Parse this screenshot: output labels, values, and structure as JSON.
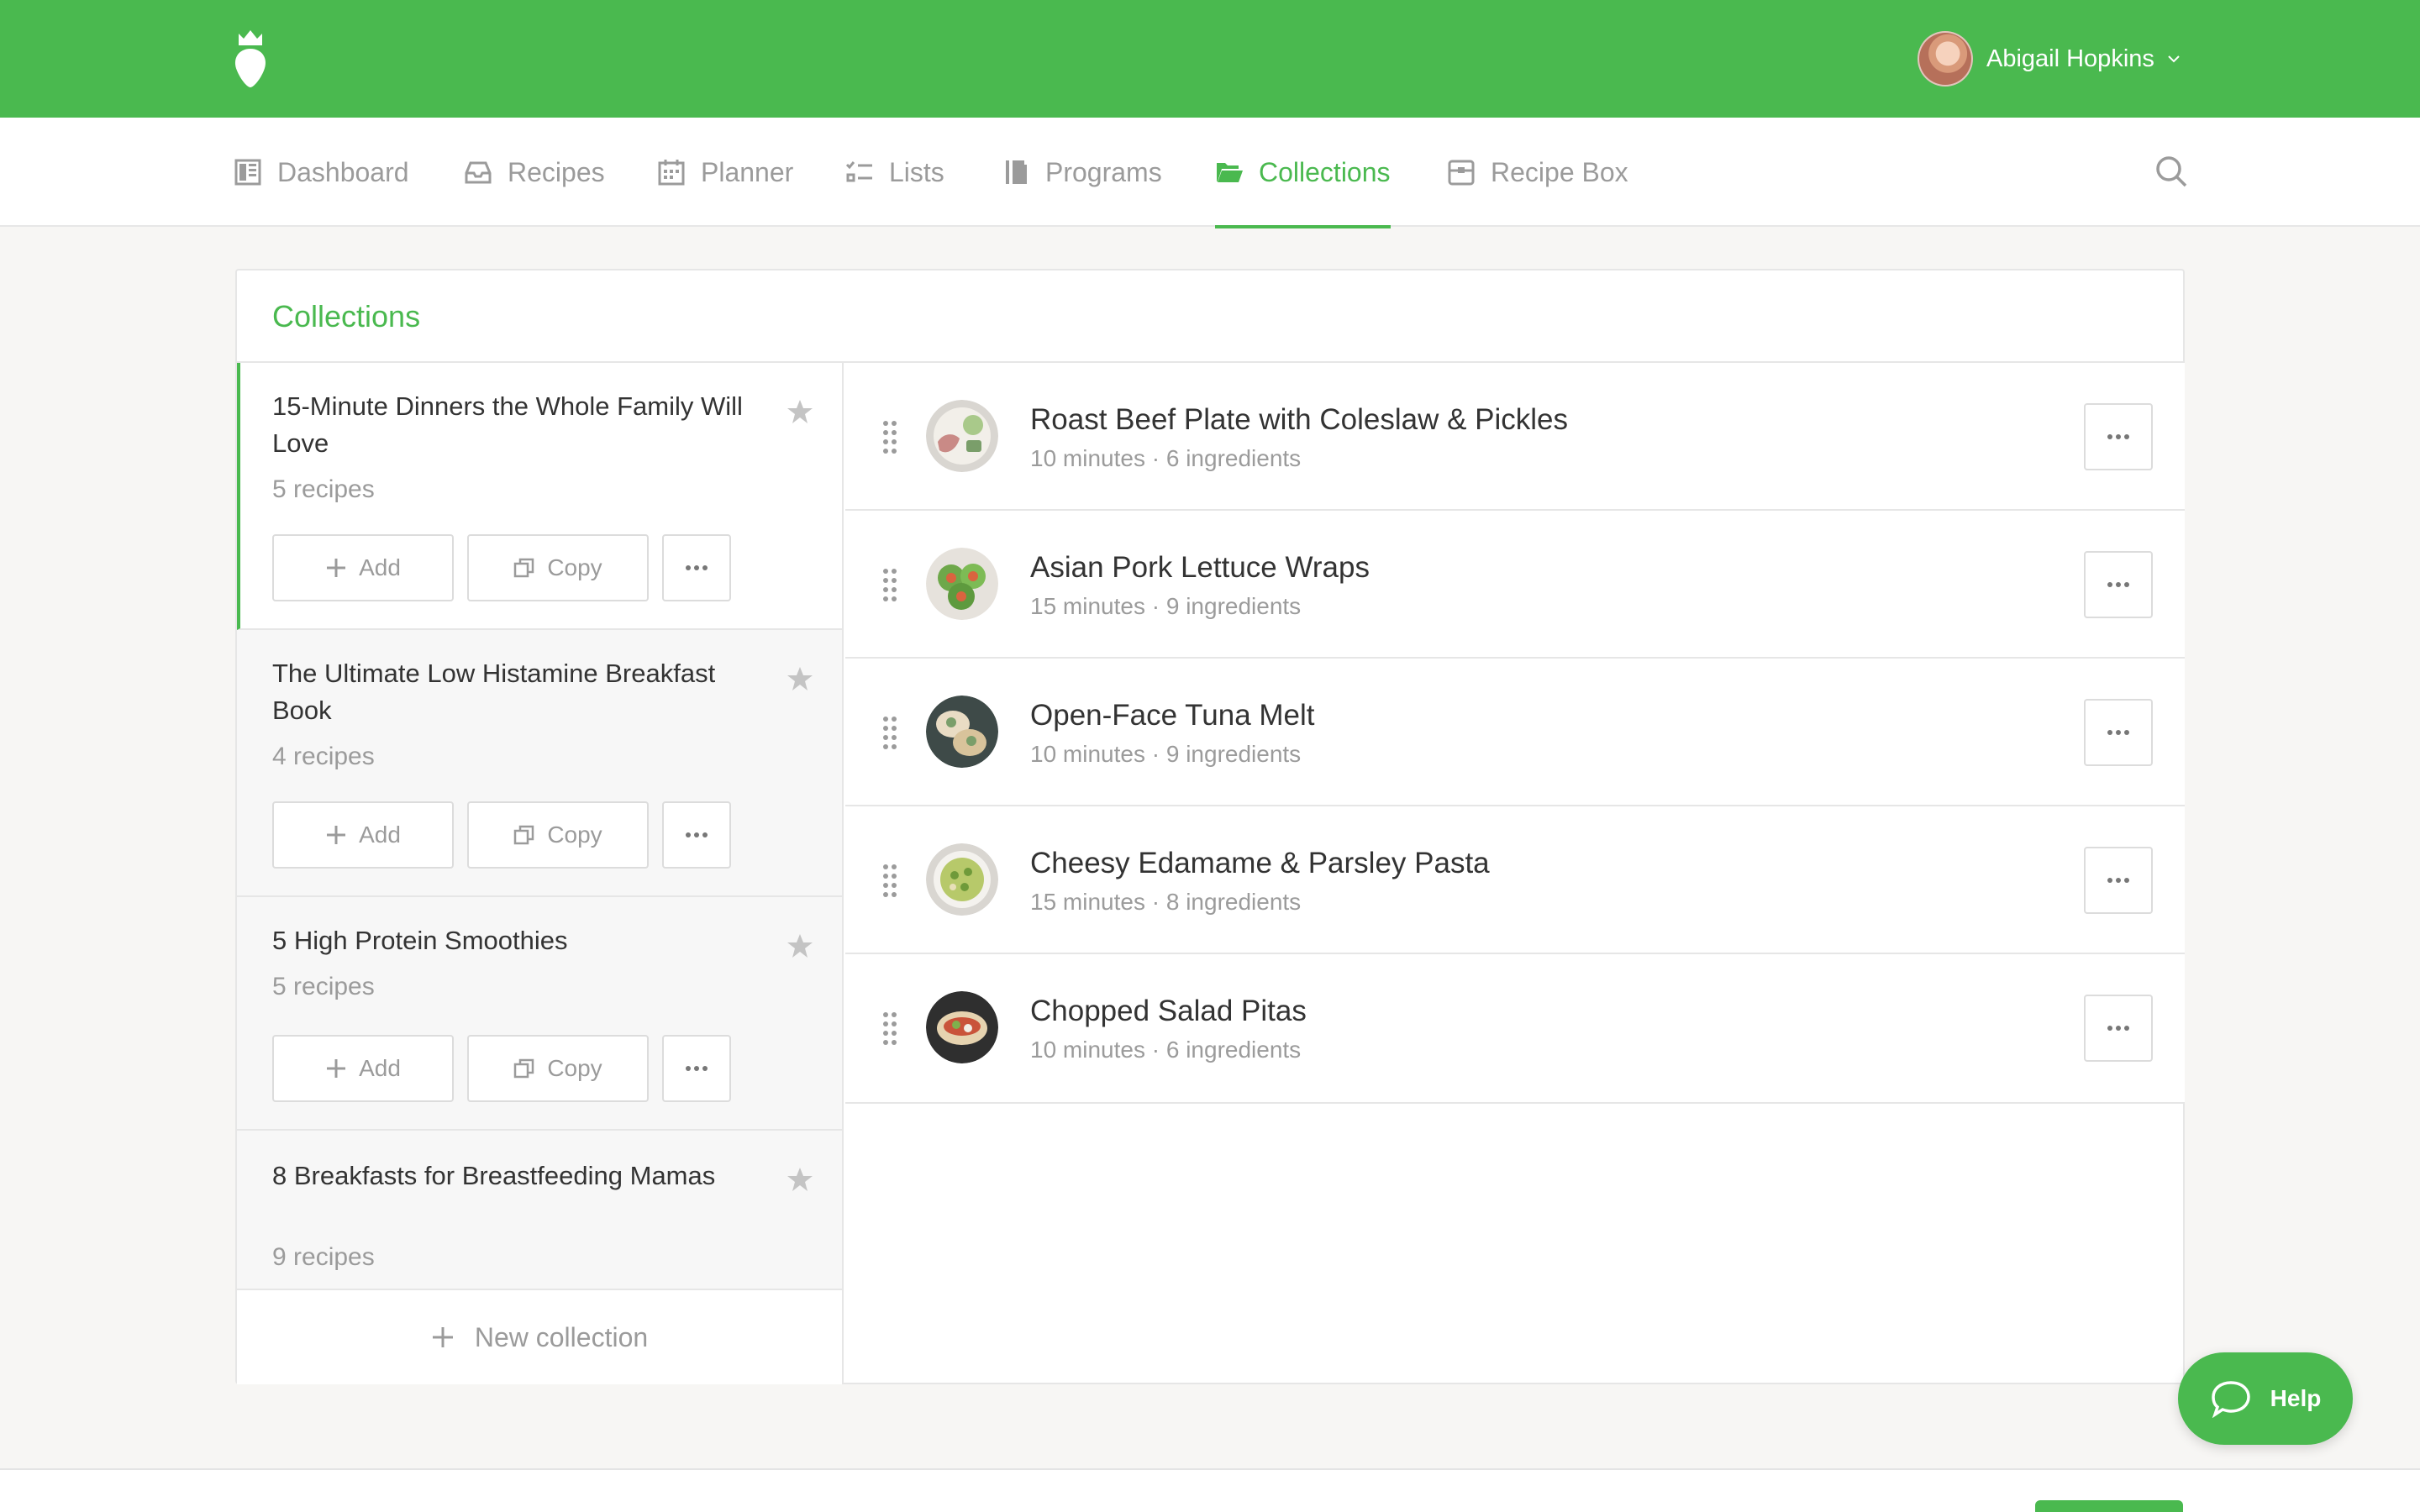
{
  "header": {
    "user_name": "Abigail Hopkins",
    "brand_color": "#4ab94f"
  },
  "nav": {
    "items": [
      {
        "label": "Dashboard",
        "icon": "dashboard-icon"
      },
      {
        "label": "Recipes",
        "icon": "recipes-icon"
      },
      {
        "label": "Planner",
        "icon": "calendar-icon"
      },
      {
        "label": "Lists",
        "icon": "checklist-icon"
      },
      {
        "label": "Programs",
        "icon": "book-icon"
      },
      {
        "label": "Collections",
        "icon": "folder-icon",
        "active": true
      },
      {
        "label": "Recipe Box",
        "icon": "box-icon"
      }
    ]
  },
  "panel": {
    "title": "Collections",
    "collections": [
      {
        "title": "15-Minute Dinners the Whole Family Will Love",
        "count": "5 recipes",
        "active": true
      },
      {
        "title": "The Ultimate Low Histamine Breakfast Book",
        "count": "4 recipes"
      },
      {
        "title": "5 High Protein Smoothies",
        "count": "5 recipes"
      },
      {
        "title": "8 Breakfasts for Breastfeeding Mamas",
        "count": "9 recipes"
      }
    ],
    "add_label": "Add",
    "copy_label": "Copy",
    "new_collection_label": "New collection"
  },
  "recipes": [
    {
      "title": "Roast Beef Plate with Coleslaw & Pickles",
      "meta": "10 minutes · 6 ingredients"
    },
    {
      "title": "Asian Pork Lettuce Wraps",
      "meta": "15 minutes · 9 ingredients"
    },
    {
      "title": "Open-Face Tuna Melt",
      "meta": "10 minutes · 9 ingredients"
    },
    {
      "title": "Cheesy Edamame & Parsley Pasta",
      "meta": "15 minutes · 8 ingredients"
    },
    {
      "title": "Chopped Salad Pitas",
      "meta": "10 minutes · 6 ingredients"
    }
  ],
  "help": {
    "label": "Help"
  }
}
